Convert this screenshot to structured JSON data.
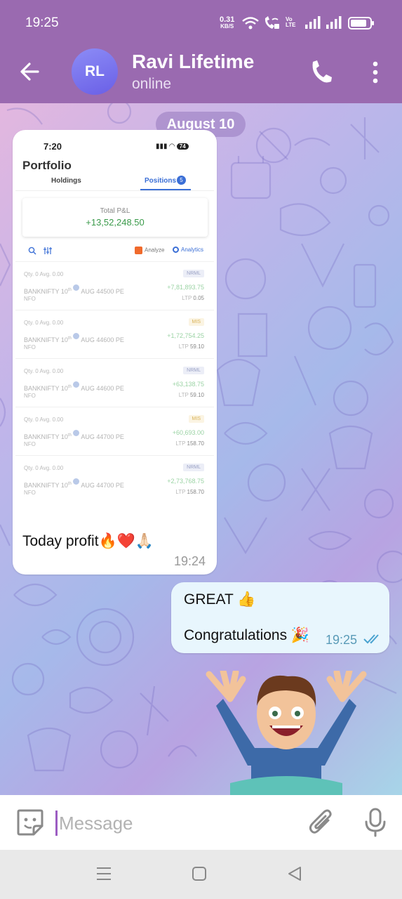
{
  "status_bar": {
    "time": "19:25",
    "net_speed_value": "0.31",
    "net_speed_unit": "KB/S",
    "volte": "Vo LTE",
    "battery_level": 0.85
  },
  "header": {
    "avatar_initials": "RL",
    "title": "Ravi Lifetime",
    "status": "online"
  },
  "chat": {
    "date_chip": "August 10",
    "incoming": {
      "screenshot": {
        "time": "7:20",
        "battery": "74",
        "page_title": "Portfolio",
        "tabs": [
          {
            "label": "Holdings"
          },
          {
            "label": "Positions",
            "badge": "5"
          }
        ],
        "total_pnl_label": "Total P&L",
        "total_pnl_value": "+13,52,248.50",
        "tools": {
          "analyze": "Analyze",
          "analytics": "Analytics"
        },
        "positions": [
          {
            "qty": "Qty. 0  Avg. 0.00",
            "tag": "NRML",
            "symbol": "BANKNIFTY 10",
            "sup": "th",
            "expiry": "AUG 44500 PE",
            "pnl": "+7,81,893.75",
            "exchange": "NFO",
            "ltp_label": "LTP",
            "ltp": "0.05"
          },
          {
            "qty": "Qty. 0  Avg. 0.00",
            "tag": "MIS",
            "symbol": "BANKNIFTY 10",
            "sup": "th",
            "expiry": "AUG 44600 PE",
            "pnl": "+1,72,754.25",
            "exchange": "NFO",
            "ltp_label": "LTP",
            "ltp": "59.10"
          },
          {
            "qty": "Qty. 0  Avg. 0.00",
            "tag": "NRML",
            "symbol": "BANKNIFTY 10",
            "sup": "th",
            "expiry": "AUG 44600 PE",
            "pnl": "+63,138.75",
            "exchange": "NFO",
            "ltp_label": "LTP",
            "ltp": "59.10"
          },
          {
            "qty": "Qty. 0  Avg. 0.00",
            "tag": "MIS",
            "symbol": "BANKNIFTY 10",
            "sup": "th",
            "expiry": "AUG 44700 PE",
            "pnl": "+60,693.00",
            "exchange": "NFO",
            "ltp_label": "LTP",
            "ltp": "158.70"
          },
          {
            "qty": "Qty. 0  Avg. 0.00",
            "tag": "NRML",
            "symbol": "BANKNIFTY 10",
            "sup": "th",
            "expiry": "AUG 44700 PE",
            "pnl": "+2,73,768.75",
            "exchange": "NFO",
            "ltp_label": "LTP",
            "ltp": "158.70"
          }
        ]
      },
      "caption": "Today profit🔥❤️🙏🏻",
      "time": "19:24"
    },
    "outgoing": {
      "line1": "GREAT 👍",
      "line2": "Congratulations 🎉",
      "time": "19:25",
      "read_status": "double-check-icon"
    },
    "sticker": "bitmoji-cheering-sticker"
  },
  "input_bar": {
    "placeholder": "Message",
    "value": ""
  },
  "colors": {
    "header_bg": "#9a6ab0",
    "outgoing_bubble": "#e8f6fd",
    "accent": "#9c5cc2"
  }
}
